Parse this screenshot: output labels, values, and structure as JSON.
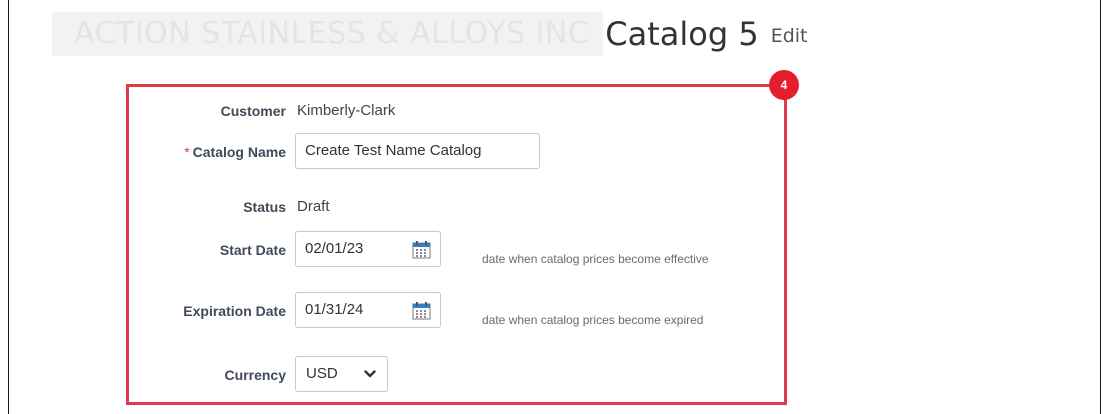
{
  "header": {
    "company": "ACTION STAINLESS & ALLOYS INC",
    "title": "Catalog 5",
    "edit_label": "Edit"
  },
  "step_badge": "4",
  "form": {
    "customer": {
      "label": "Customer",
      "value": "Kimberly-Clark"
    },
    "catalog_name": {
      "required_mark": "*",
      "label": "Catalog Name",
      "value": "Create Test Name Catalog"
    },
    "status": {
      "label": "Status",
      "value": "Draft"
    },
    "start_date": {
      "label": "Start Date",
      "value": "02/01/23",
      "hint": "date when catalog prices become effective",
      "icon": "calendar-icon"
    },
    "expiration_date": {
      "label": "Expiration Date",
      "value": "01/31/24",
      "hint": "date when catalog prices become expired",
      "icon": "calendar-icon"
    },
    "currency": {
      "label": "Currency",
      "value": "USD",
      "icon": "chevron-down-icon"
    }
  },
  "colors": {
    "highlight": "#e03a4c",
    "badge": "#e41e2d",
    "label": "#404a59",
    "calendar": "#2f7fc8"
  }
}
